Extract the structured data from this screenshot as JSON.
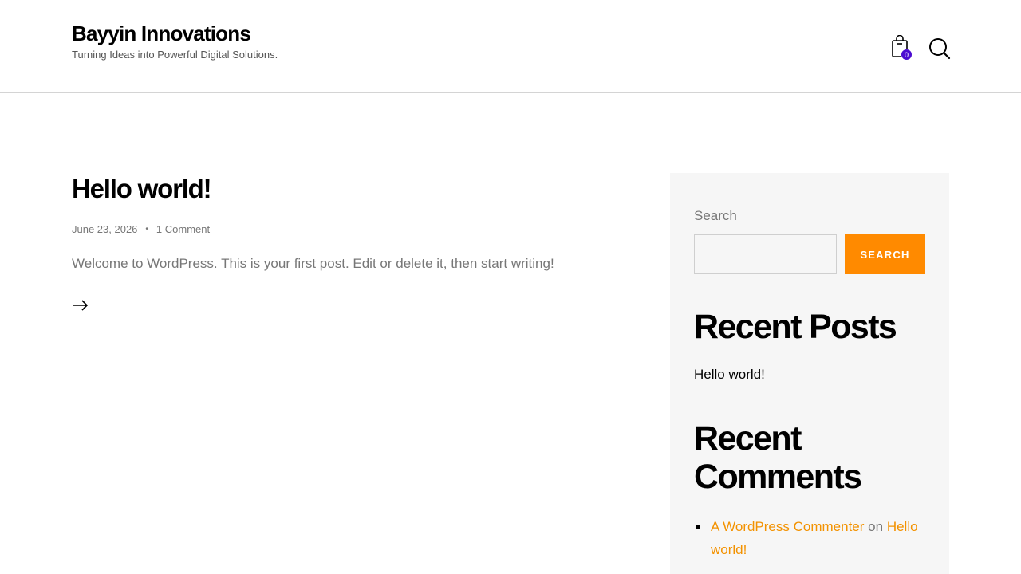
{
  "header": {
    "site_title": "Bayyin Innovations",
    "tagline": "Turning Ideas into Powerful Digital Solutions.",
    "cart_count": "0",
    "icons": {
      "cart": "shopping-bag-icon",
      "search": "search-icon"
    }
  },
  "post": {
    "title": "Hello world!",
    "date": "June 23, 2026",
    "separator": "•",
    "comments": "1 Comment",
    "excerpt": "Welcome to WordPress. This is your first post. Edit or delete it, then start writing!",
    "read_more_icon": "arrow-right-icon"
  },
  "sidebar": {
    "search_label": "Search",
    "search_placeholder": "",
    "search_button": "SEARCH",
    "recent_posts_heading": "Recent Posts",
    "recent_posts": [
      "Hello world!"
    ],
    "recent_comments_heading": "Recent Comments",
    "recent_comments": [
      {
        "author": "A WordPress Commenter",
        "connector": "on",
        "post": "Hello world!"
      }
    ]
  },
  "colors": {
    "accent": "#ff8a00",
    "link": "#f39200",
    "badge": "#4b0bd1",
    "sidebar_bg": "#f6f6f6",
    "muted_text": "#777777"
  }
}
